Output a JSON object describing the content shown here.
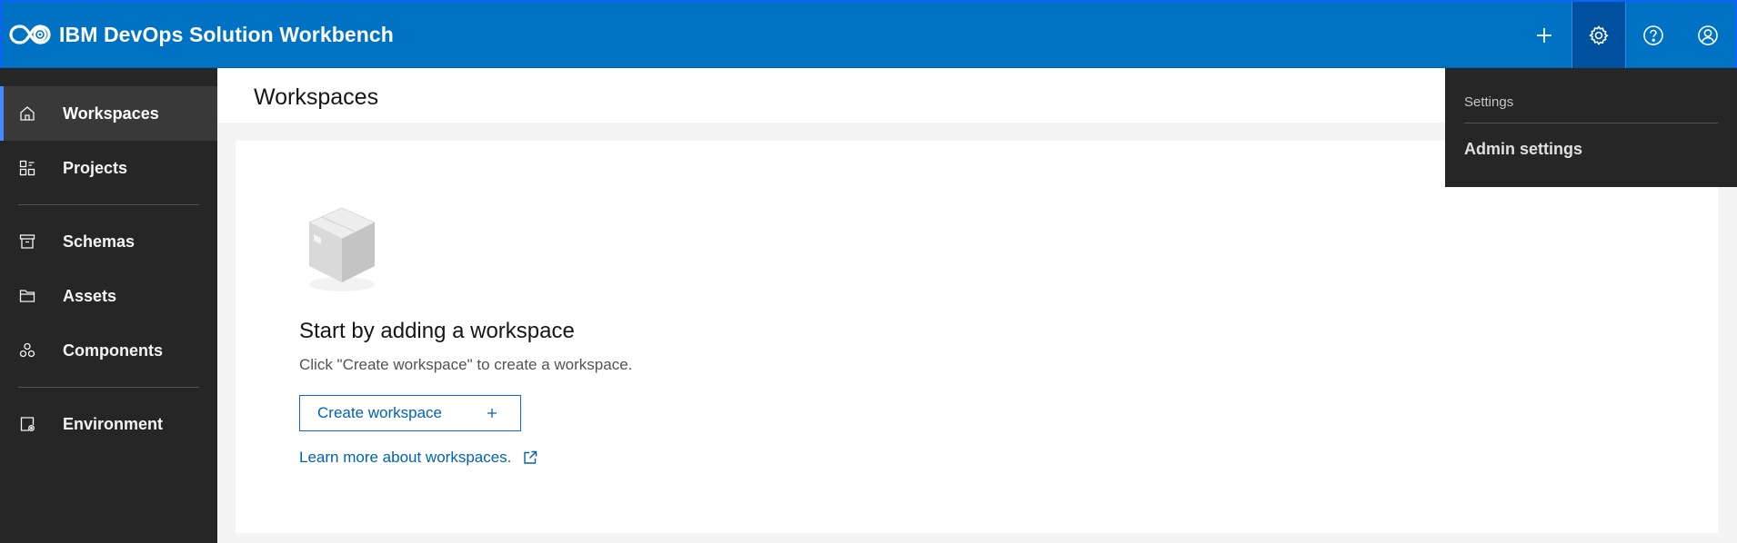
{
  "app": {
    "title": "IBM DevOps Solution Workbench"
  },
  "header": {
    "actions": [
      {
        "name": "add-icon"
      },
      {
        "name": "gear-icon",
        "active": true
      },
      {
        "name": "help-icon"
      },
      {
        "name": "user-icon"
      }
    ]
  },
  "sidebar": {
    "items": [
      {
        "label": "Workspaces",
        "icon": "home-icon",
        "active": true
      },
      {
        "label": "Projects",
        "icon": "projects-icon"
      },
      {
        "label": "Schemas",
        "icon": "archive-icon"
      },
      {
        "label": "Assets",
        "icon": "folder-icon"
      },
      {
        "label": "Components",
        "icon": "components-icon"
      },
      {
        "label": "Environment",
        "icon": "environment-icon"
      }
    ]
  },
  "main": {
    "page_title": "Workspaces",
    "empty_state": {
      "title": "Start by adding a workspace",
      "text": "Click \"Create workspace\" to create a workspace.",
      "button_label": "Create workspace",
      "link_label": "Learn more about workspaces."
    }
  },
  "settings_menu": {
    "heading": "Settings",
    "items": [
      "Admin settings"
    ]
  },
  "colors": {
    "header_bg": "#0072c3",
    "sidebar_bg": "#262626",
    "active_accent": "#4589ff",
    "link": "#0062b1"
  }
}
